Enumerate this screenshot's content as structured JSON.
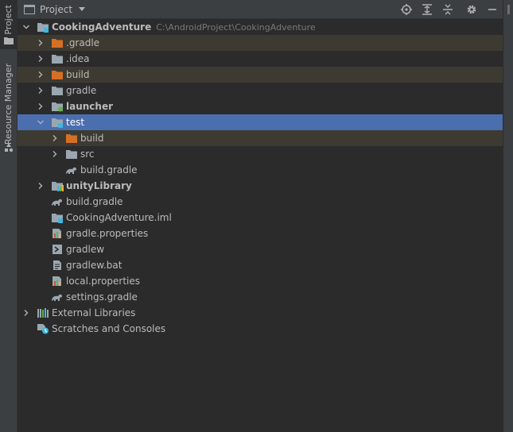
{
  "side": {
    "project_tab": "Project",
    "resource_tab": "Resource Manager"
  },
  "header": {
    "title": "Project",
    "tools": [
      "locate-icon",
      "expand-all-icon",
      "collapse-all-icon",
      "gear-icon",
      "minimize-icon"
    ]
  },
  "tree": [
    {
      "id": "root",
      "label": "CookingAdventure",
      "path": "C:\\AndroidProject\\CookingAdventure",
      "depth": 0,
      "expanded": true,
      "icon": "module-folder",
      "bold": true,
      "excluded": false
    },
    {
      "id": "dot-gradle",
      "label": ".gradle",
      "depth": 1,
      "expanded": false,
      "icon": "folder-orange",
      "excluded": true
    },
    {
      "id": "dot-idea",
      "label": ".idea",
      "depth": 1,
      "expanded": false,
      "icon": "folder-gray",
      "excluded": false
    },
    {
      "id": "build",
      "label": "build",
      "depth": 1,
      "expanded": false,
      "icon": "folder-orange",
      "excluded": true
    },
    {
      "id": "gradle",
      "label": "gradle",
      "depth": 1,
      "expanded": false,
      "icon": "folder-gray",
      "excluded": false
    },
    {
      "id": "launcher",
      "label": "launcher",
      "depth": 1,
      "expanded": false,
      "icon": "module-green",
      "bold": true,
      "excluded": false
    },
    {
      "id": "test",
      "label": "test",
      "depth": 1,
      "expanded": true,
      "icon": "module-folder",
      "selected": true,
      "excluded": false
    },
    {
      "id": "test-build",
      "label": "build",
      "depth": 2,
      "expanded": false,
      "icon": "folder-orange",
      "excluded": true
    },
    {
      "id": "test-src",
      "label": "src",
      "depth": 2,
      "expanded": false,
      "icon": "folder-gray",
      "excluded": false
    },
    {
      "id": "test-build-gradle",
      "label": "build.gradle",
      "depth": 2,
      "icon": "gradle",
      "excluded": false
    },
    {
      "id": "unityLibrary",
      "label": "unityLibrary",
      "depth": 1,
      "expanded": false,
      "icon": "module-lib",
      "bold": true,
      "excluded": false
    },
    {
      "id": "build-gradle",
      "label": "build.gradle",
      "depth": 1,
      "icon": "gradle",
      "excluded": false
    },
    {
      "id": "iml",
      "label": "CookingAdventure.iml",
      "depth": 1,
      "icon": "module-folder",
      "excluded": false
    },
    {
      "id": "gradle-properties",
      "label": "gradle.properties",
      "depth": 1,
      "icon": "properties",
      "excluded": false
    },
    {
      "id": "gradlew",
      "label": "gradlew",
      "depth": 1,
      "icon": "shell",
      "excluded": false
    },
    {
      "id": "gradlew-bat",
      "label": "gradlew.bat",
      "depth": 1,
      "icon": "text-file",
      "excluded": false
    },
    {
      "id": "local-properties",
      "label": "local.properties",
      "depth": 1,
      "icon": "properties",
      "excluded": false
    },
    {
      "id": "settings-gradle",
      "label": "settings.gradle",
      "depth": 1,
      "icon": "gradle",
      "excluded": false
    },
    {
      "id": "external-libraries",
      "label": "External Libraries",
      "depth": 0,
      "expanded": false,
      "icon": "libraries",
      "excluded": false
    },
    {
      "id": "scratches",
      "label": "Scratches and Consoles",
      "depth": 0,
      "icon": "scratches",
      "excluded": false
    }
  ],
  "colors": {
    "background": "#2b2b2b",
    "panel": "#3c3f41",
    "selection": "#4b6eaf",
    "excluded_row": "#3d3b31",
    "folder_gray": "#9aa7b0",
    "folder_orange": "#d66f26",
    "text": "#bbbbbb",
    "path_text": "#787878"
  }
}
